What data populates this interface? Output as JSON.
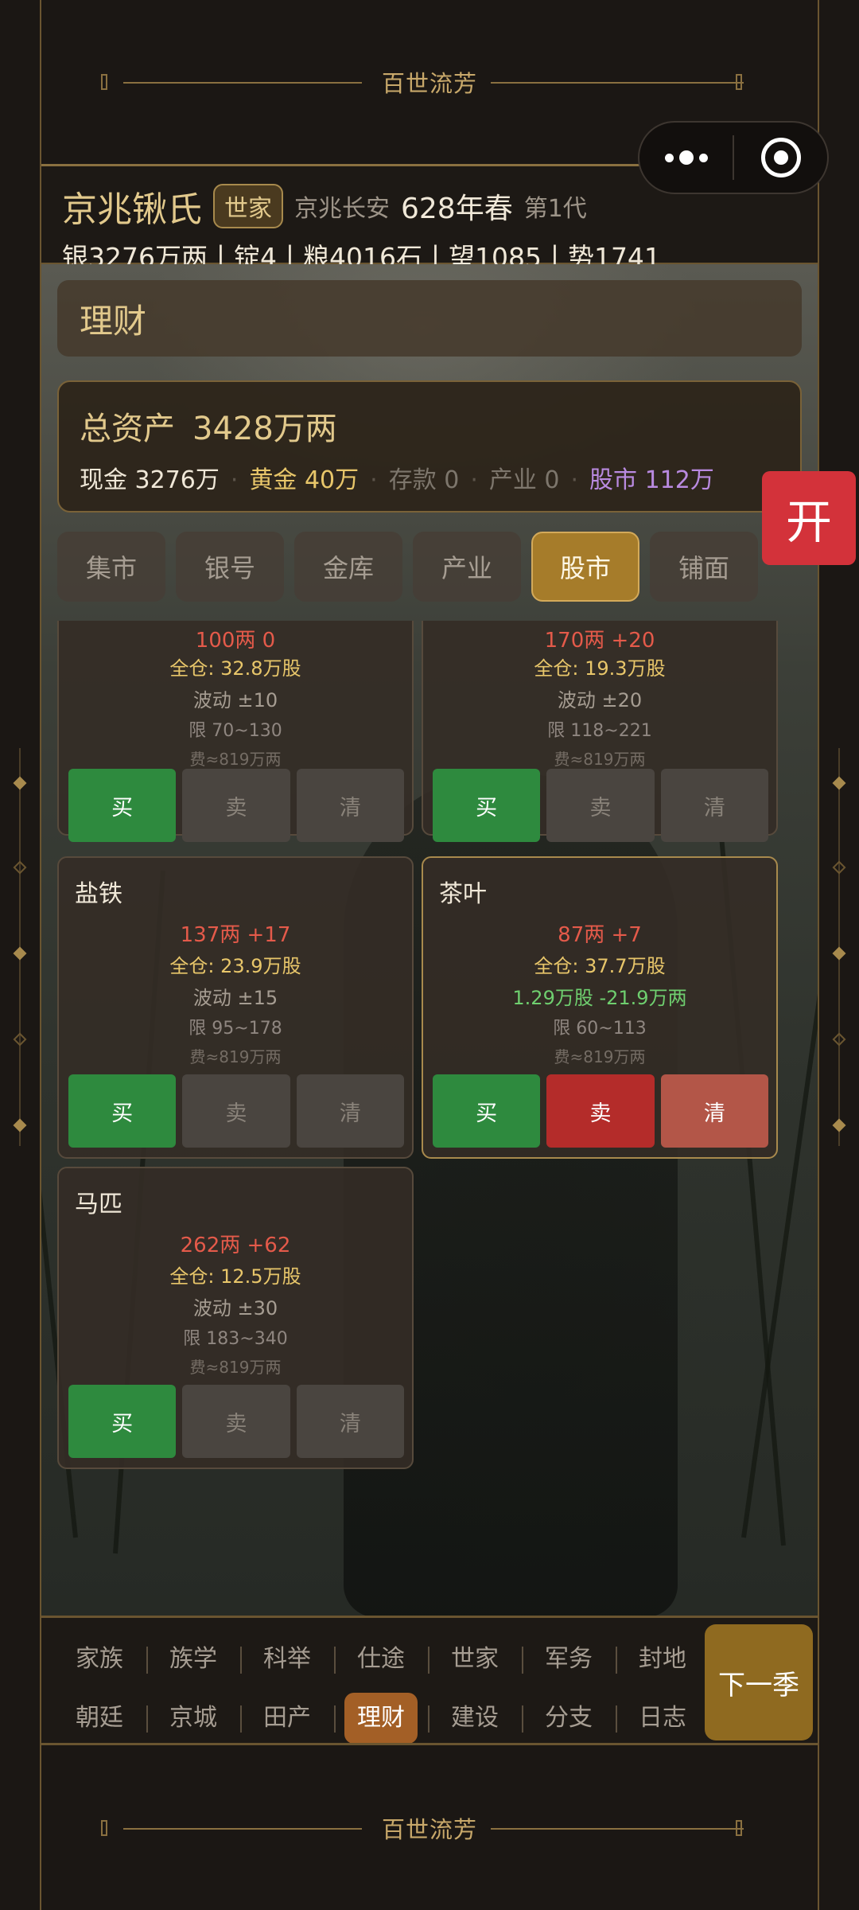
{
  "app": {
    "banner_title": "百世流芳"
  },
  "header": {
    "clan_name": "京兆锹氏",
    "clan_rank": "世家",
    "location": "京兆长安",
    "year": "628年春",
    "generation": "第1代",
    "resources": "银3276万两丨锭4丨粮4016石丨望1085丨势1741"
  },
  "page": {
    "title": "理财",
    "open_button": "开"
  },
  "summary": {
    "total_label": "总资产",
    "total_value": "3428万两",
    "cash": "现金 3276万",
    "gold": "黄金 40万",
    "deposit": "存款 0",
    "property": "产业 0",
    "stock": "股市 112万",
    "separator": "·"
  },
  "tabs": [
    {
      "label": "集市",
      "active": false
    },
    {
      "label": "银号",
      "active": false
    },
    {
      "label": "金库",
      "active": false
    },
    {
      "label": "产业",
      "active": false
    },
    {
      "label": "股市",
      "active": true
    },
    {
      "label": "铺面",
      "active": false
    }
  ],
  "cards": [
    {
      "name": "",
      "price": "100两 0",
      "position": "全仓: 32.8万股",
      "volatility": "波动 ±10",
      "holding": "",
      "limit": "限 70~130",
      "fee": "费≈819万两",
      "buy": "买",
      "sell": "卖",
      "clear": "清",
      "owned": false
    },
    {
      "name": "",
      "price": "170两 +20",
      "position": "全仓: 19.3万股",
      "volatility": "波动 ±20",
      "holding": "",
      "limit": "限 118~221",
      "fee": "费≈819万两",
      "buy": "买",
      "sell": "卖",
      "clear": "清",
      "owned": false
    },
    {
      "name": "盐铁",
      "price": "137两 +17",
      "position": "全仓: 23.9万股",
      "volatility": "波动 ±15",
      "holding": "",
      "limit": "限 95~178",
      "fee": "费≈819万两",
      "buy": "买",
      "sell": "卖",
      "clear": "清",
      "owned": false
    },
    {
      "name": "茶叶",
      "price": "87两 +7",
      "position": "全仓: 37.7万股",
      "volatility": "",
      "holding": "1.29万股 -21.9万两",
      "limit": "限 60~113",
      "fee": "费≈819万两",
      "buy": "买",
      "sell": "卖",
      "clear": "清",
      "owned": true
    },
    {
      "name": "马匹",
      "price": "262两 +62",
      "position": "全仓: 12.5万股",
      "volatility": "波动 ±30",
      "holding": "",
      "limit": "限 183~340",
      "fee": "费≈819万两",
      "buy": "买",
      "sell": "卖",
      "clear": "清",
      "owned": false
    }
  ],
  "nav": {
    "row1": [
      "家族",
      "族学",
      "科举",
      "仕途",
      "世家",
      "军务",
      "封地"
    ],
    "row2": [
      "朝廷",
      "京城",
      "田产",
      "理财",
      "建设",
      "分支",
      "日志"
    ],
    "active": "理财",
    "next_button": "下一季"
  },
  "colors": {
    "accent_gold": "#e2c98c",
    "price_red": "#e45a4a",
    "buy_green": "#2e8a3e",
    "sell_red": "#b42c2a",
    "stock_purple": "#b98ae0",
    "active_tab": "#a67c2a"
  }
}
